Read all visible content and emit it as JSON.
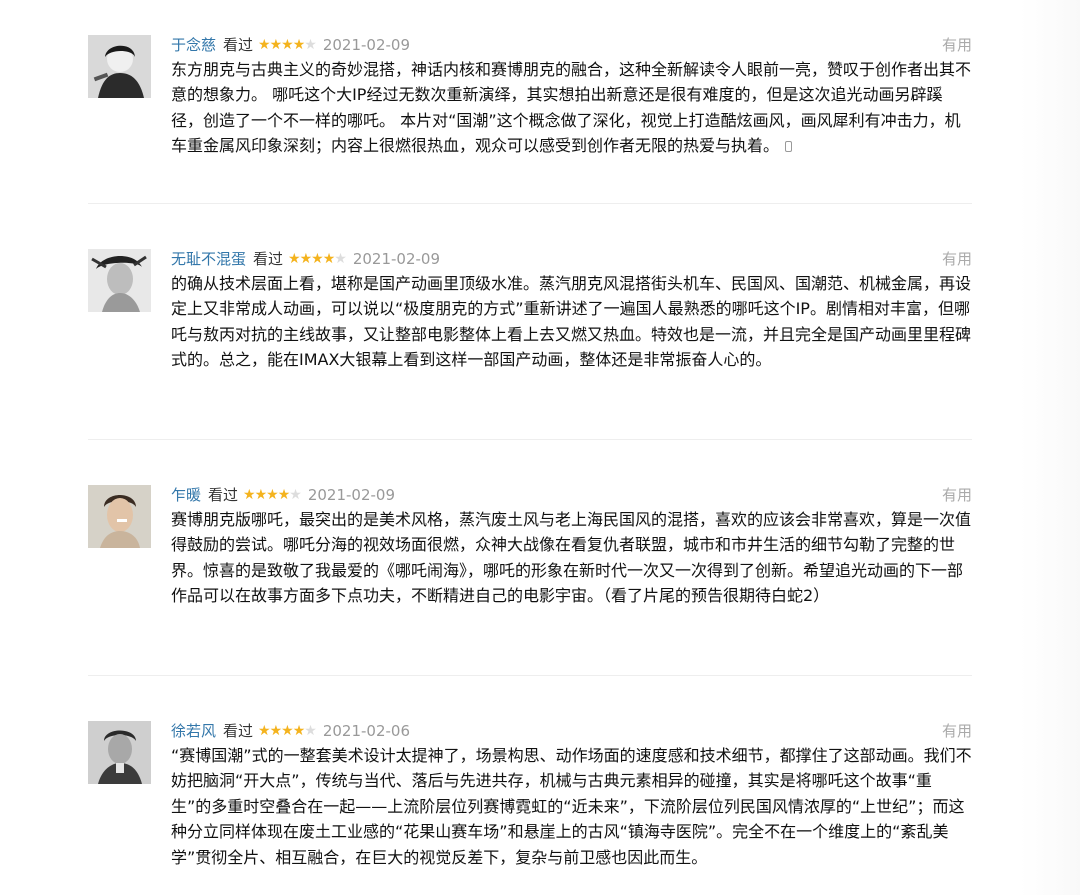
{
  "useful_label": "有用",
  "watched_label": "看过",
  "colors": {
    "username": "#3377aa",
    "star_filled": "#f4b31e",
    "star_empty": "#dddddd",
    "date": "#999999"
  },
  "reviews": [
    {
      "username": "于念慈",
      "rating": 4,
      "rating_max": 5,
      "date": "2021-02-09",
      "avatar_icon": "avatar-icon",
      "text": "东方朋克与古典主义的奇妙混搭，神话内核和赛博朋克的融合，这种全新解读令人眼前一亮，赞叹于创作者出其不意的想象力。 哪吒这个大IP经过无数次重新演绎，其实想拍出新意还是很有难度的，但是这次追光动画另辟蹊径，创造了一个不一样的哪吒。 本片对“国潮”这个概念做了深化，视觉上打造酷炫画风，画风犀利有冲击力，机车重金属风印象深刻；内容上很燃很热血，观众可以感受到创作者无限的热爱与执着。"
    },
    {
      "username": "无耻不混蛋",
      "rating": 4,
      "rating_max": 5,
      "date": "2021-02-09",
      "avatar_icon": "avatar-icon",
      "text": "的确从技术层面上看，堪称是国产动画里顶级水准。蒸汽朋克风混搭街头机车、民国风、国潮范、机械金属，再设定上又非常成人动画，可以说以“极度朋克的方式”重新讲述了一遍国人最熟悉的哪吒这个IP。剧情相对丰富，但哪吒与敖丙对抗的主线故事，又让整部电影整体上看上去又燃又热血。特效也是一流，并且完全是国产动画里里程碑式的。总之，能在IMAX大银幕上看到这样一部国产动画，整体还是非常振奋人心的。"
    },
    {
      "username": "乍暖",
      "rating": 4,
      "rating_max": 5,
      "date": "2021-02-09",
      "avatar_icon": "avatar-icon",
      "text": "赛博朋克版哪吒，最突出的是美术风格，蒸汽废土风与老上海民国风的混搭，喜欢的应该会非常喜欢，算是一次值得鼓励的尝试。哪吒分海的视效场面很燃，众神大战像在看复仇者联盟，城市和市井生活的细节勾勒了完整的世界。惊喜的是致敬了我最爱的《哪吒闹海》，哪吒的形象在新时代一次又一次得到了创新。希望追光动画的下一部作品可以在故事方面多下点功夫，不断精进自己的电影宇宙。（看了片尾的预告很期待白蛇2）"
    },
    {
      "username": "徐若风",
      "rating": 4,
      "rating_max": 5,
      "date": "2021-02-06",
      "avatar_icon": "avatar-icon",
      "text": "“赛博国潮”式的一整套美术设计太提神了，场景构思、动作场面的速度感和技术细节，都撑住了这部动画。我们不妨把脑洞“开大点”，传统与当代、落后与先进共存，机械与古典元素相异的碰撞，其实是将哪吒这个故事“重生”的多重时空叠合在一起——上流阶层位列赛博霓虹的“近未来”，下流阶层位列民国风情浓厚的“上世纪”；而这种分立同样体现在废土工业感的“花果山赛车场”和悬崖上的古风“镇海寺医院”。完全不在一个维度上的“紊乱美学”贯彻全片、相互融合，在巨大的视觉反差下，复杂与前卫感也因此而生。"
    }
  ]
}
